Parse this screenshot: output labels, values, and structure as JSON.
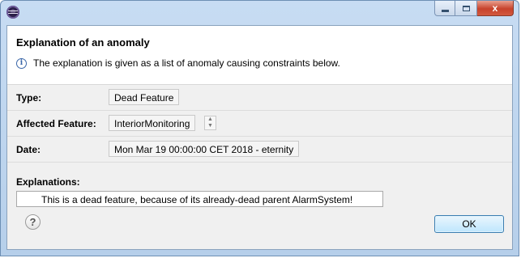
{
  "window": {
    "min_glyph": "",
    "max_glyph": "",
    "close_label": "x"
  },
  "header": {
    "title": "Explanation of an anomaly",
    "message": "The explanation is given as a list of anomaly causing constraints below.",
    "info_icon": "i"
  },
  "fields": {
    "type_label": "Type:",
    "type_value": "Dead Feature",
    "affected_label": "Affected Feature:",
    "affected_value": "InteriorMonitoring",
    "date_label": "Date:",
    "date_value": "Mon Mar 19 00:00:00 CET 2018 - eternity"
  },
  "explanations": {
    "label": "Explanations:",
    "items": [
      "This is a dead feature, because of its already-dead parent AlarmSystem!"
    ]
  },
  "footer": {
    "help_glyph": "?",
    "ok_label": "OK"
  },
  "icons": {
    "app": "eclipse-icon",
    "info": "info-icon",
    "help": "help-icon"
  }
}
